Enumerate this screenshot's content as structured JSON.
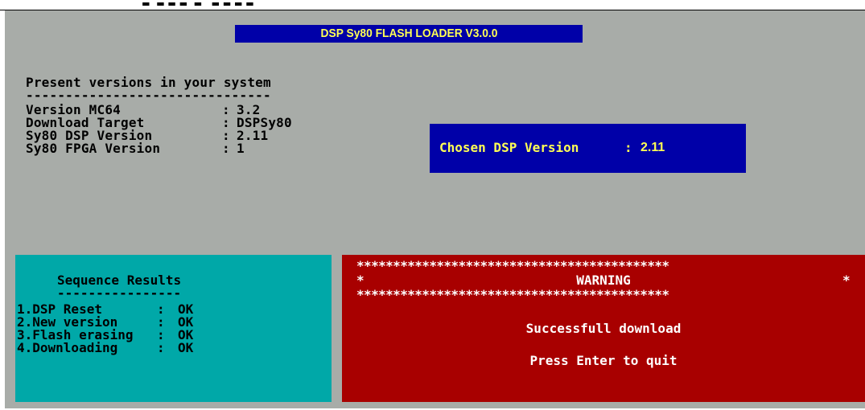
{
  "top_strip": {
    "text": "                                              ▬  ▬ ▬ ▬  ▬   ▬ ▬ ▬ ▬"
  },
  "title": "DSP Sy80 FLASH LOADER V3.0.0",
  "present": {
    "heading": "Present versions in your system",
    "underline": "-------------------------------",
    "rows": [
      {
        "label": "Version MC64",
        "sep": ":",
        "value": "3.2"
      },
      {
        "label": "Download Target",
        "sep": ":",
        "value": "DSPSy80"
      },
      {
        "label": "Sy80 DSP Version",
        "sep": ":",
        "value": "2.11"
      },
      {
        "label": "Sy80 FPGA Version",
        "sep": ":",
        "value": "1"
      }
    ]
  },
  "chosen": {
    "label": "Chosen DSP Version",
    "sep": ":",
    "value": "2.11"
  },
  "sequence": {
    "heading": "Sequence Results",
    "underline": "----------------",
    "items": [
      {
        "label": "1.DSP Reset",
        "sep": ":",
        "value": "OK"
      },
      {
        "label": "2.New version",
        "sep": ":",
        "value": "OK"
      },
      {
        "label": "3.Flash erasing",
        "sep": ":",
        "value": "OK"
      },
      {
        "label": "4.Downloading",
        "sep": ":",
        "value": "OK"
      }
    ]
  },
  "warning": {
    "stars_line": "*******************************************",
    "star_edge": "*",
    "heading": "WARNING",
    "message": "Successfull download",
    "prompt": "Press Enter to quit"
  },
  "colors": {
    "screen_bg": "#a8aca8",
    "title_bg": "#0000a8",
    "title_fg": "#ffff54",
    "sequence_bg": "#00a8a8",
    "warning_bg": "#a80000"
  }
}
